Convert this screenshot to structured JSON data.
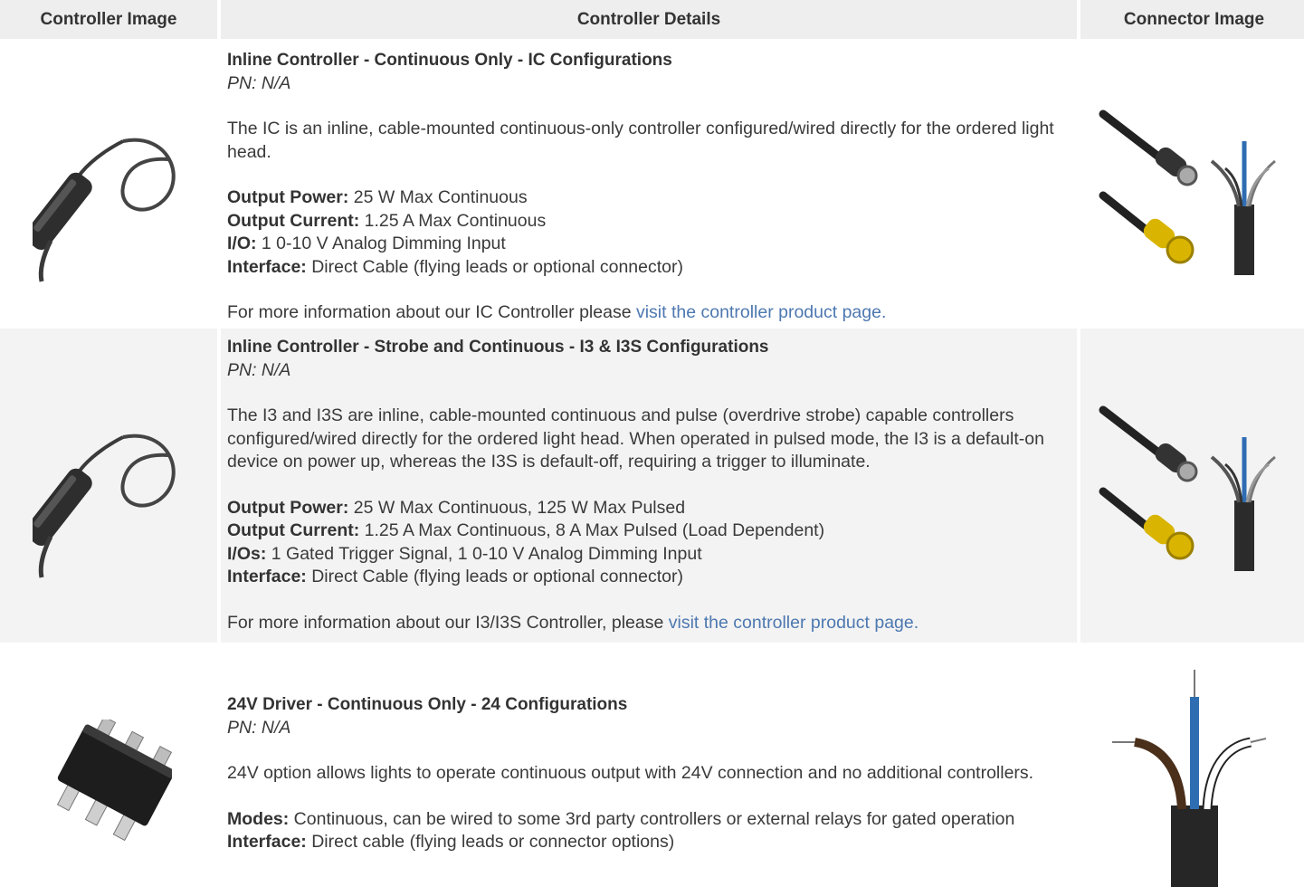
{
  "headers": {
    "controller_image": "Controller Image",
    "controller_details": "Controller Details",
    "connector_image": "Connector Image"
  },
  "rows": [
    {
      "title": "Inline Controller - Continuous Only - IC Configurations",
      "pn": "PN: N/A",
      "description": "The IC is an inline, cable-mounted continuous-only controller configured/wired directly for the ordered light head.",
      "specs": [
        {
          "label": "Output Power:",
          "value": " 25 W Max Continuous"
        },
        {
          "label": "Output Current:",
          "value": " 1.25 A Max Continuous"
        },
        {
          "label": "I/O:",
          "value": " 1 0-10 V Analog Dimming Input"
        },
        {
          "label": "Interface:",
          "value": " Direct Cable (flying leads or optional connector)"
        }
      ],
      "more_text": "For more information about our IC Controller please ",
      "more_link": "visit the controller product page."
    },
    {
      "title": "Inline Controller - Strobe and Continuous - I3 & I3S Configurations",
      "pn": "PN: N/A",
      "description": "The I3 and I3S are inline, cable-mounted continuous and pulse (overdrive strobe) capable controllers configured/wired directly for the ordered light head. When operated in pulsed mode, the I3 is a default-on device on power up, whereas the I3S is default-off, requiring a trigger to illuminate.",
      "specs": [
        {
          "label": "Output Power:",
          "value": " 25 W Max Continuous, 125 W Max Pulsed"
        },
        {
          "label": "Output Current:",
          "value": " 1.25 A Max Continuous, 8 A Max Pulsed (Load Dependent)"
        },
        {
          "label": "I/Os:",
          "value": " 1 Gated Trigger Signal, 1 0-10 V Analog Dimming Input"
        },
        {
          "label": "Interface:",
          "value": " Direct Cable (flying leads or optional connector)"
        }
      ],
      "more_text": "For more information about our I3/I3S Controller, please ",
      "more_link": "visit the controller product page."
    },
    {
      "title": "24V Driver - Continuous Only - 24 Configurations",
      "pn": "PN: N/A",
      "description": "24V option allows lights to operate continuous output with 24V connection and no additional controllers.",
      "specs": [
        {
          "label": "Modes:",
          "value": " Continuous, can be wired to some 3rd party controllers or external relays for gated operation"
        },
        {
          "label": "Interface:",
          "value": " Direct cable (flying leads or connector options)"
        }
      ]
    }
  ],
  "colors": {
    "link": "#4d78b0",
    "header_bg": "#eeeeee",
    "shade_bg": "#f3f3f3"
  },
  "icons": [
    "inline-controller-image",
    "m12-connector-image",
    "flying-leads-image",
    "smd-driver-chip-image"
  ]
}
